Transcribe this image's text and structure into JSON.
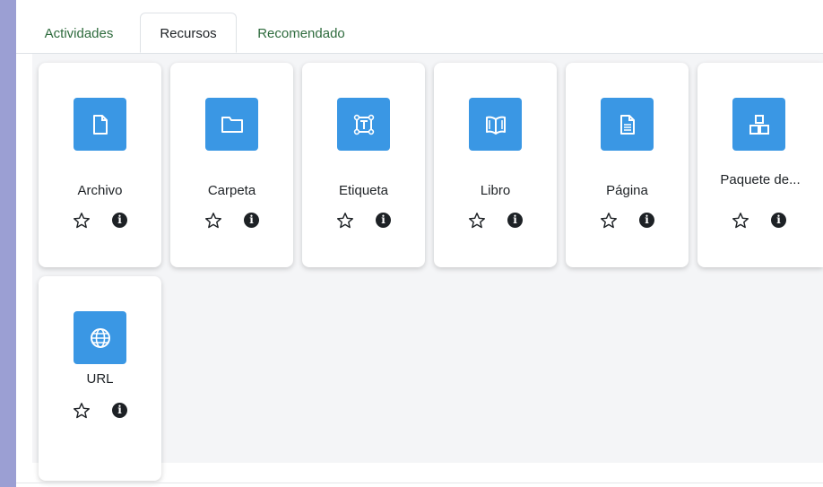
{
  "tabs": [
    {
      "label": "Actividades",
      "active": false
    },
    {
      "label": "Recursos",
      "active": true
    },
    {
      "label": "Recomendado",
      "active": false
    }
  ],
  "resources": [
    {
      "label": "Archivo",
      "icon": "file-icon"
    },
    {
      "label": "Carpeta",
      "icon": "folder-icon"
    },
    {
      "label": "Etiqueta",
      "icon": "text-label-icon"
    },
    {
      "label": "Libro",
      "icon": "book-icon"
    },
    {
      "label": "Página",
      "icon": "page-icon"
    },
    {
      "label": "Paquete de...",
      "icon": "package-icon"
    },
    {
      "label": "URL",
      "icon": "globe-icon"
    }
  ],
  "colors": {
    "accent": "#3a97e4",
    "tab_link": "#2e6b3d",
    "outer_bg": "#9b9fd3",
    "content_bg": "#f4f5f7"
  }
}
